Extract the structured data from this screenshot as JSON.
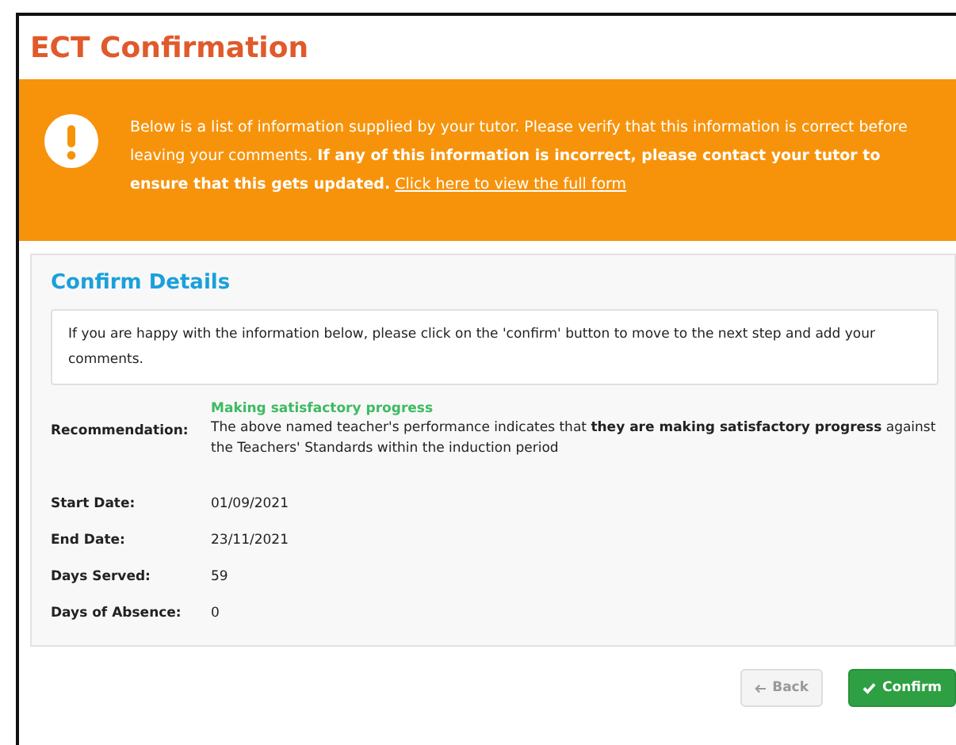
{
  "page_title": "ECT Confirmation",
  "notice": {
    "text": "Below is a list of information supplied by your tutor. Please verify that this information is correct before leaving your comments. **If any of this information is incorrect, please contact your tutor to ensure that this gets updated.**",
    "link": "Click here to view the full form"
  },
  "panel": {
    "title": "Confirm Details",
    "info": "If you are happy with the information below, please click on the 'confirm' button to move to the next step and add your comments.",
    "recommendation": {
      "label": "Recommendation:",
      "status": "Making satisfactory progress",
      "text": "The above named teacher's performance indicates that **they are making satisfactory progress** against the Teachers' Standards within the induction period"
    },
    "fields": [
      {
        "label": "Start Date:",
        "value": "01/09/2021"
      },
      {
        "label": "End Date:",
        "value": "23/11/2021"
      },
      {
        "label": "Days Served:",
        "value": "59"
      },
      {
        "label": "Days of Absence:",
        "value": "0"
      }
    ]
  },
  "buttons": [
    {
      "kind": "back",
      "label": "Back",
      "disabled": true
    },
    {
      "kind": "confirm",
      "label": "Confirm",
      "disabled": false
    }
  ]
}
